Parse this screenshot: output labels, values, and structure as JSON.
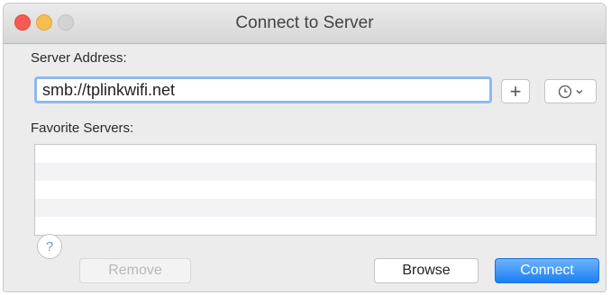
{
  "window": {
    "title": "Connect to Server"
  },
  "server_address": {
    "label": "Server Address:",
    "value": "smb://tplinkwifi.net"
  },
  "add_button_label": "+",
  "favorites": {
    "label": "Favorite Servers:",
    "items": []
  },
  "buttons": {
    "help": "?",
    "remove": "Remove",
    "browse": "Browse",
    "connect": "Connect"
  },
  "colors": {
    "accent": "#1b7ff4",
    "focus_ring": "#8fb8ee",
    "close": "#f55a53",
    "minimize": "#f6be4f"
  },
  "icons": {
    "recent": "clock-icon",
    "dropdown": "chevron-down-icon"
  }
}
